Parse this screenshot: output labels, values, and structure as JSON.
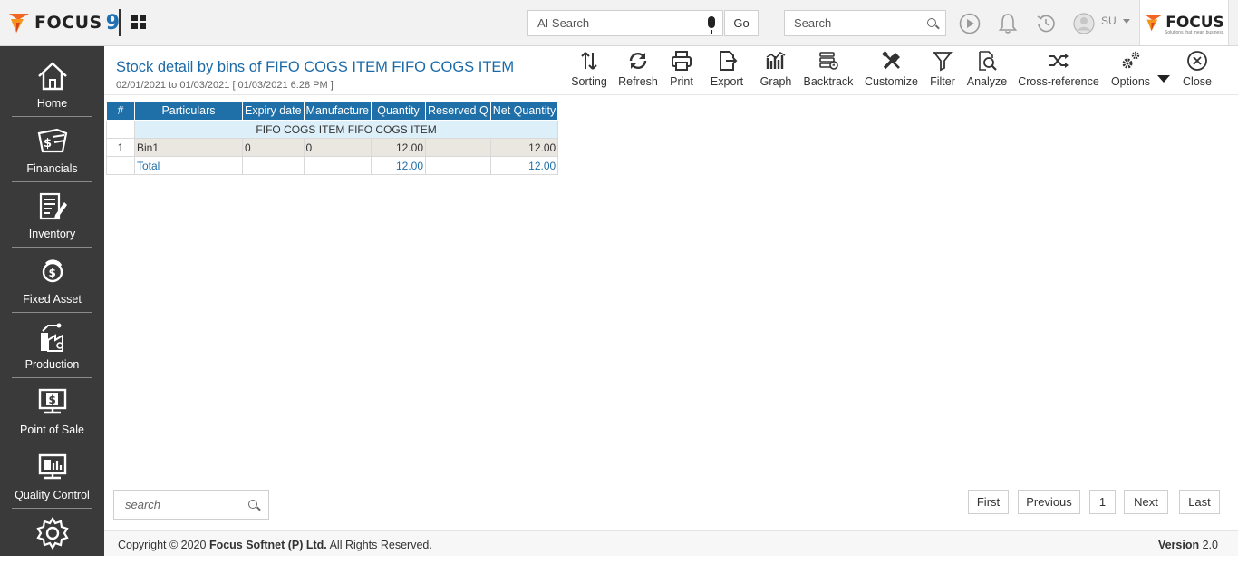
{
  "header": {
    "logo_text": "FOCUS",
    "logo_number": "9",
    "ai_search": {
      "placeholder": "AI Search"
    },
    "go_label": "Go",
    "search": {
      "placeholder": "Search"
    },
    "user_initials": "SU",
    "brand_text": "FOCUS",
    "brand_tagline": "Solutions that mean business",
    "icons": [
      "play-icon",
      "bell-icon",
      "history-icon",
      "user-avatar-icon"
    ]
  },
  "sidebar": {
    "items": [
      {
        "label": "Home",
        "icon": "home-icon"
      },
      {
        "label": "Financials",
        "icon": "financials-icon"
      },
      {
        "label": "Inventory",
        "icon": "inventory-icon"
      },
      {
        "label": "Fixed Asset",
        "icon": "fixed-asset-icon"
      },
      {
        "label": "Production",
        "icon": "production-icon"
      },
      {
        "label": "Point of Sale",
        "icon": "point-of-sale-icon"
      },
      {
        "label": "Quality Control",
        "icon": "quality-control-icon"
      },
      {
        "label": "Settings",
        "icon": "settings-icon"
      }
    ]
  },
  "report": {
    "title": "Stock detail by bins of FIFO COGS ITEM FIFO COGS ITEM",
    "subtitle": "02/01/2021 to 01/03/2021 [ 01/03/2021 6:28 PM ]"
  },
  "toolbar": {
    "items": [
      {
        "label": "Sorting",
        "icon": "sorting-icon"
      },
      {
        "label": "Refresh",
        "icon": "refresh-icon"
      },
      {
        "label": "Print",
        "icon": "print-icon"
      },
      {
        "label": "Export",
        "icon": "export-icon"
      },
      {
        "label": "Graph",
        "icon": "graph-icon"
      },
      {
        "label": "Backtrack",
        "icon": "backtrack-icon"
      },
      {
        "label": "Customize",
        "icon": "customize-icon"
      },
      {
        "label": "Filter",
        "icon": "filter-icon"
      },
      {
        "label": "Analyze",
        "icon": "analyze-icon"
      },
      {
        "label": "Cross-reference",
        "icon": "cross-reference-icon"
      },
      {
        "label": "Options",
        "icon": "options-icon"
      },
      {
        "label": "Close",
        "icon": "close-icon"
      }
    ]
  },
  "table": {
    "columns": [
      "#",
      "Particulars",
      "Expiry date",
      "Manufacture",
      "Quantity",
      "Reserved Q",
      "Net Quantity"
    ],
    "group_label": "FIFO COGS ITEM FIFO COGS ITEM",
    "rows": [
      {
        "index": "1",
        "particulars": "Bin1",
        "expiry": "0",
        "manufacture": "0",
        "quantity": "12.00",
        "reserved": "",
        "net_quantity": "12.00"
      }
    ],
    "total": {
      "label": "Total",
      "quantity": "12.00",
      "net_quantity": "12.00"
    }
  },
  "bottom": {
    "search_placeholder": "search",
    "pager": {
      "first": "First",
      "previous": "Previous",
      "page": "1",
      "next": "Next",
      "last": "Last"
    }
  },
  "footer": {
    "copyright_prefix": "Copyright © 2020 ",
    "company": "Focus Softnet (P) Ltd.",
    "copyright_suffix": " All Rights Reserved.",
    "version_label": "Version",
    "version_number": "2.0"
  },
  "colors": {
    "accent": "#1f6fa8",
    "sidebar_bg": "#3a3a3a",
    "group_row_bg": "#ddf0f9",
    "data_row_bg": "#eae7e1",
    "logo_orange": "#f26522"
  }
}
